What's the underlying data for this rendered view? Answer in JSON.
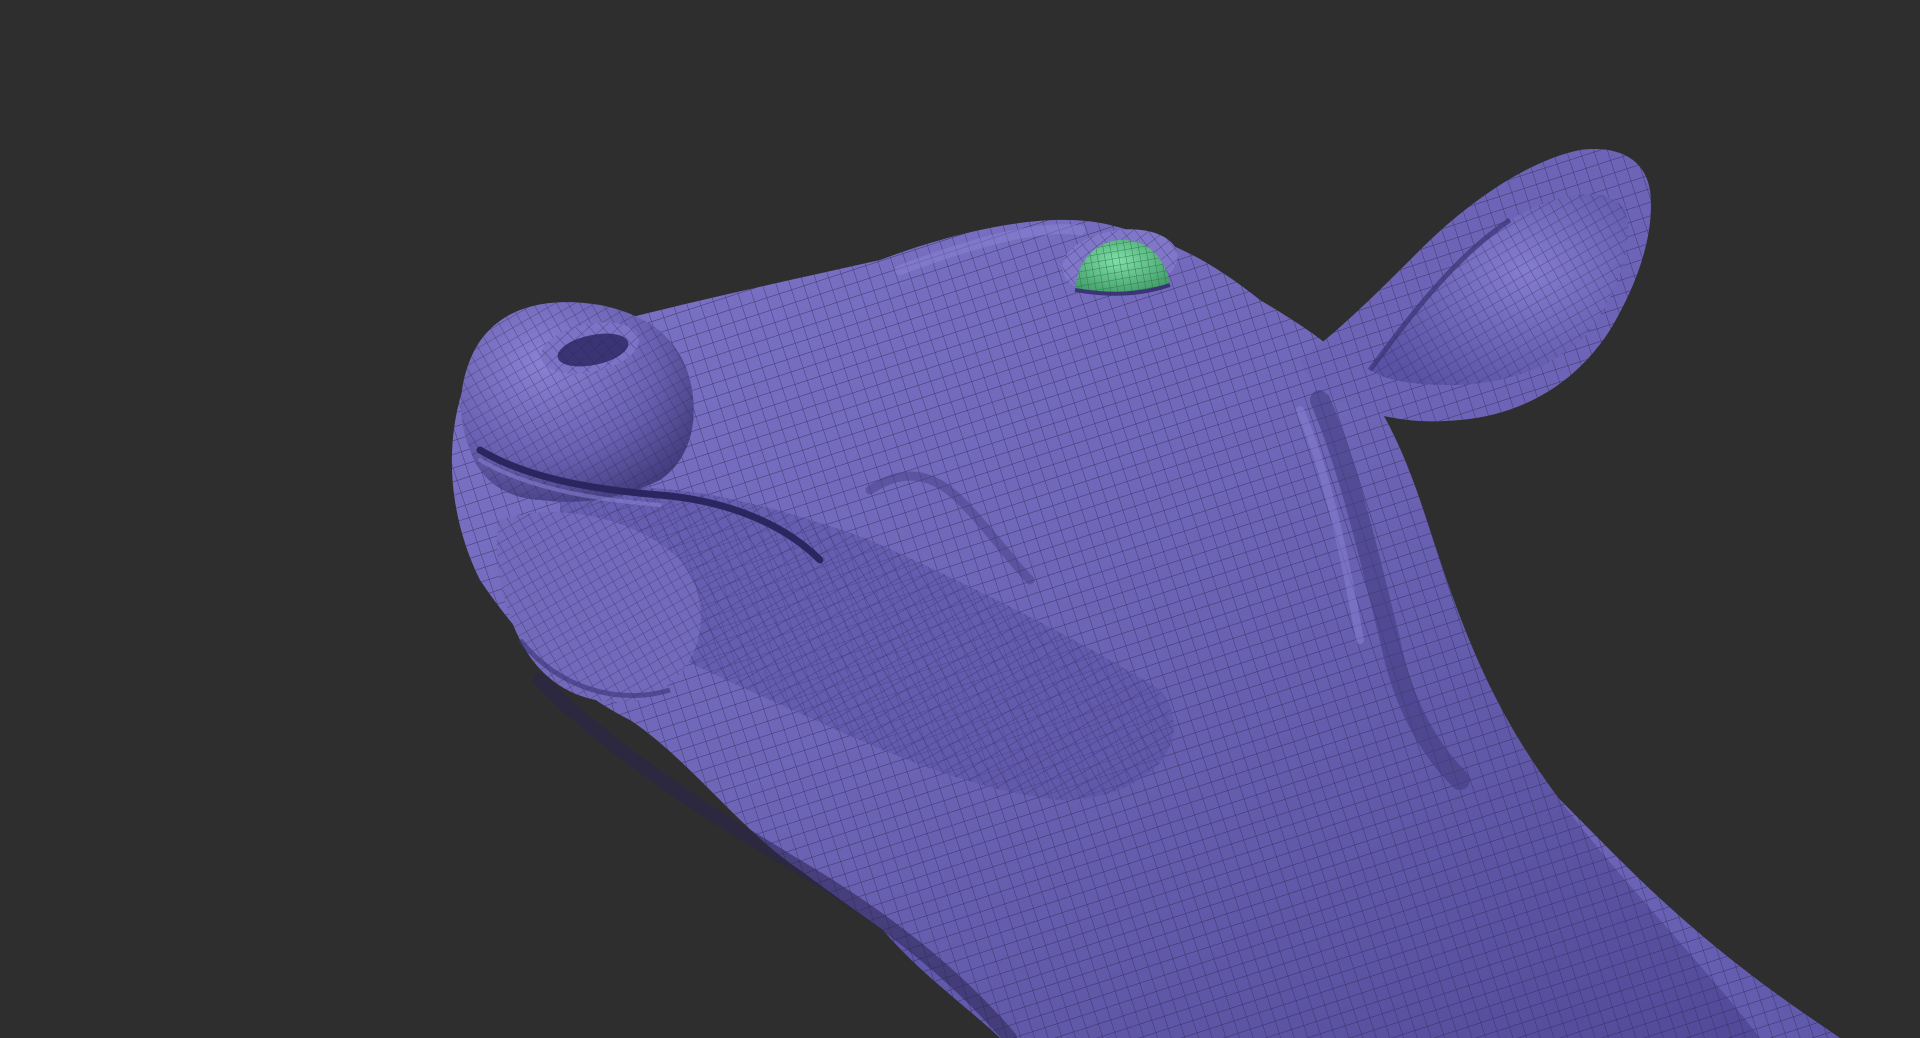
{
  "viewport": {
    "background_color": "#2e2e2e",
    "mesh": {
      "subject": "cow-head-sculpt",
      "body_color": "#6f66b8",
      "highlight_color": "#8b82d2",
      "shadow_color": "#3f3878",
      "wire_color": "#2a2550",
      "eye_color": "#5fc58a",
      "eye_wire_color": "#2c6a46",
      "polygroups": [
        "head-polygroup",
        "eye-polygroup"
      ]
    }
  }
}
